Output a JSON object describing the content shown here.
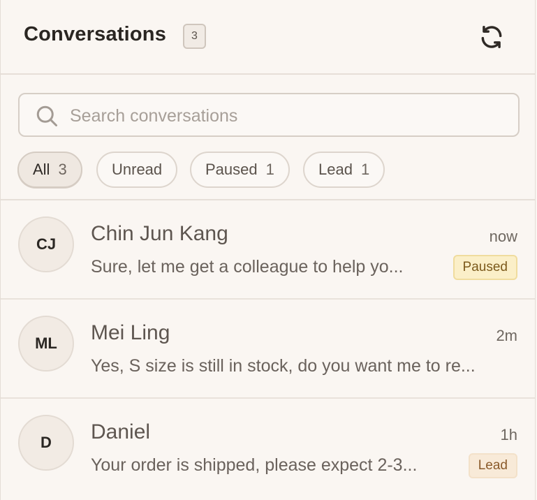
{
  "header": {
    "title": "Conversations",
    "count": "3"
  },
  "search": {
    "placeholder": "Search conversations",
    "value": ""
  },
  "filters": [
    {
      "label": "All",
      "count": "3",
      "active": true
    },
    {
      "label": "Unread",
      "count": "",
      "active": false
    },
    {
      "label": "Paused",
      "count": "1",
      "active": false
    },
    {
      "label": "Lead",
      "count": "1",
      "active": false
    }
  ],
  "conversations": [
    {
      "initials": "CJ",
      "name": "Chin Jun Kang",
      "time": "now",
      "preview": "Sure, let me get a colleague to help yo...",
      "tag": "Paused"
    },
    {
      "initials": "ML",
      "name": "Mei Ling",
      "time": "2m",
      "preview": "Yes, S size is still in stock, do you want me to re...",
      "tag": ""
    },
    {
      "initials": "D",
      "name": "Daniel",
      "time": "1h",
      "preview": "Your order is shipped, please expect 2-3...",
      "tag": "Lead"
    }
  ],
  "icons": {
    "refresh": "refresh-icon",
    "search": "search-icon"
  },
  "colors": {
    "background": "#faf6f2",
    "paused_tag_bg": "#fbefc8",
    "paused_tag_text": "#7c5a1c",
    "lead_tag_bg": "#f8ead8",
    "lead_tag_text": "#8a5a2a"
  }
}
